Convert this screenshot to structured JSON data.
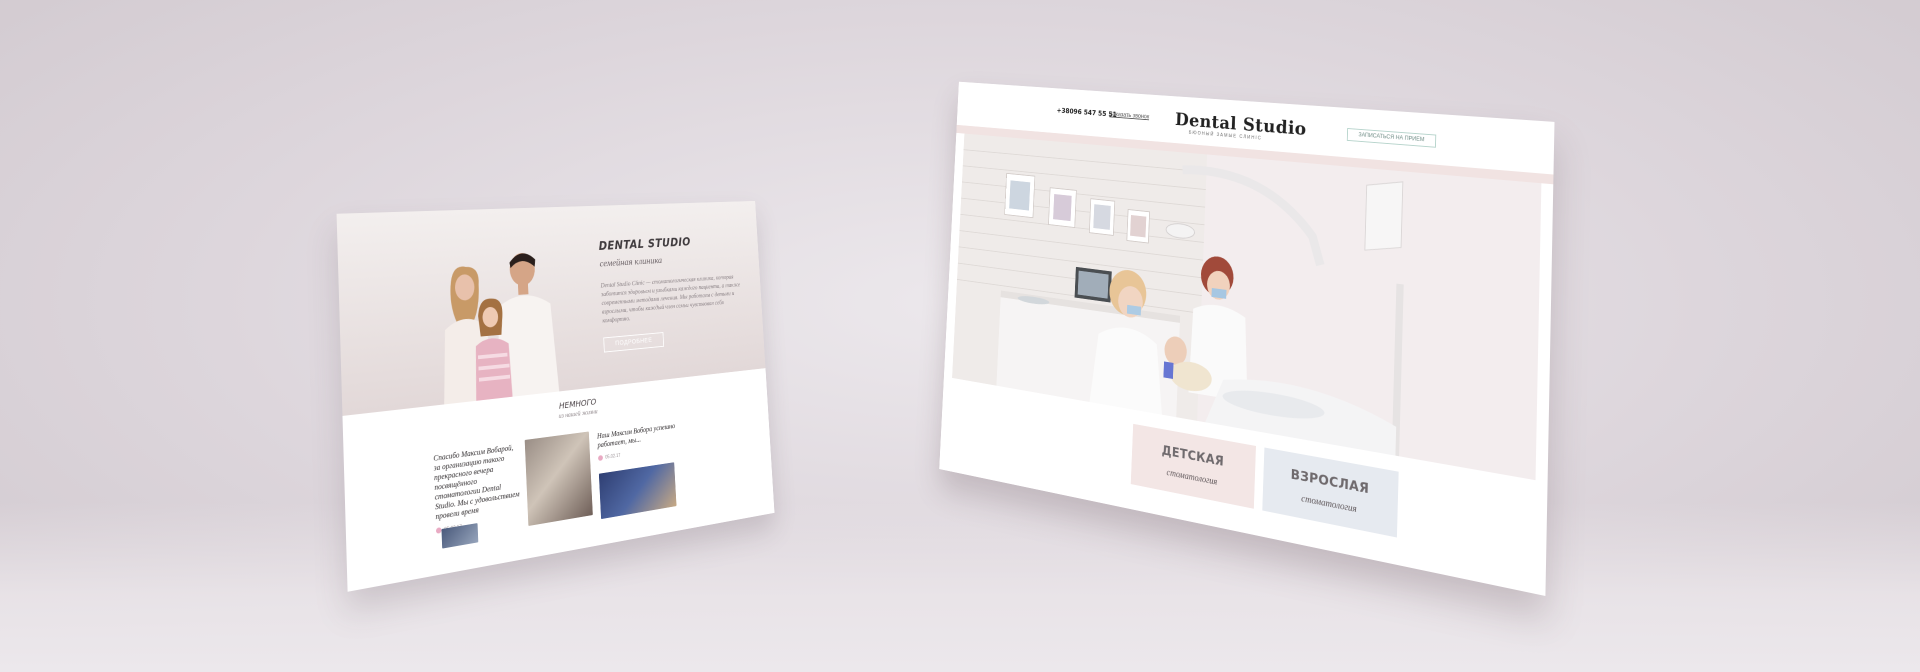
{
  "left_page": {
    "brand_title": "DENTAL STUDIO",
    "brand_subtitle": "семейная клиника",
    "brand_text": "Dental Studio Clinic — стоматологическая клиника, которая заботится здоровьем и улыбками каждого пациента, а также современными методами лечения. Мы работаем с детьми и взрослыми, чтобы каждый член семьи чувствовал себя комфортно.",
    "more_button": "ПОДРОБНЕЕ",
    "news_title": "НЕМНОГО",
    "news_subtitle": "из нашей жизни",
    "news": [
      {
        "text": "Спасибо Максим Вобарой, за организацию такого прекрасного вечера посвящённого стоматологии Dental Studio. Мы с удовольствием провели время",
        "date": "05.02.17"
      },
      {
        "text": "Наш Максим Вобора успешно работает, мы...",
        "date": "05.02.17"
      }
    ]
  },
  "right_page": {
    "phone": "+38096 547 55 51",
    "callback_link": "Заказать звонок",
    "logo_main": "Dental Studio",
    "logo_sub": "БЮОНЫЙ ЗАМЫЕ СЛИНІС",
    "appointment_button": "ЗАПИСАТЬСЯ НА ПРИЕМ",
    "services": [
      {
        "title": "ДЕТСКАЯ",
        "subtitle": "стоматология",
        "color": "#f3e6e5"
      },
      {
        "title": "ВЗРОСЛАЯ",
        "subtitle": "стоматология",
        "color": "#e6eaf0"
      }
    ]
  },
  "colors": {
    "background": "#ddd6dc",
    "accent_pink": "#f1e3e2",
    "accent_blue": "#e6eaf0",
    "button_border_green": "#b7d4cc"
  }
}
